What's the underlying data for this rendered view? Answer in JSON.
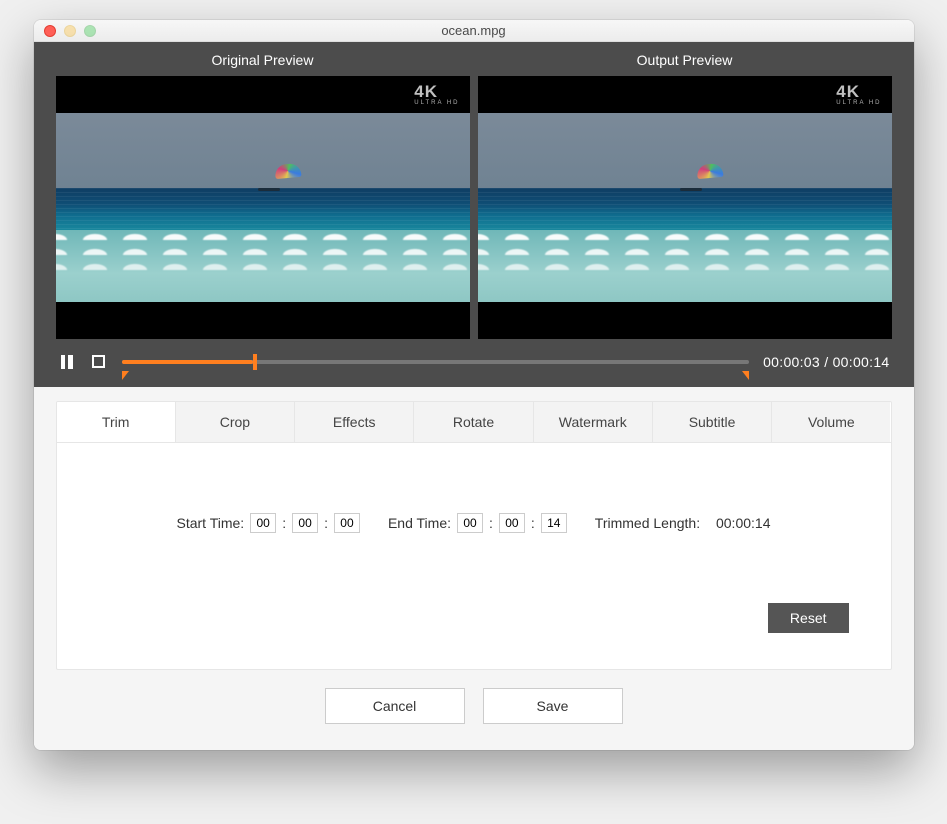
{
  "window": {
    "title": "ocean.mpg"
  },
  "preview": {
    "original_label": "Original Preview",
    "output_label": "Output  Preview",
    "badge_text": "4K",
    "badge_sub": "ULTRA HD"
  },
  "player": {
    "progress_percent": 21,
    "trim_end_percent": 100,
    "current_time": "00:00:03",
    "separator": "/",
    "total_time": "00:00:14"
  },
  "tabs": {
    "items": [
      "Trim",
      "Crop",
      "Effects",
      "Rotate",
      "Watermark",
      "Subtitle",
      "Volume"
    ],
    "active_index": 0
  },
  "trim": {
    "start_label": "Start Time:",
    "start": {
      "hh": "00",
      "mm": "00",
      "ss": "00"
    },
    "end_label": "End Time:",
    "end": {
      "hh": "00",
      "mm": "00",
      "ss": "14"
    },
    "length_label": "Trimmed Length:",
    "length_value": "00:00:14",
    "reset_label": "Reset"
  },
  "footer": {
    "cancel_label": "Cancel",
    "save_label": "Save"
  }
}
